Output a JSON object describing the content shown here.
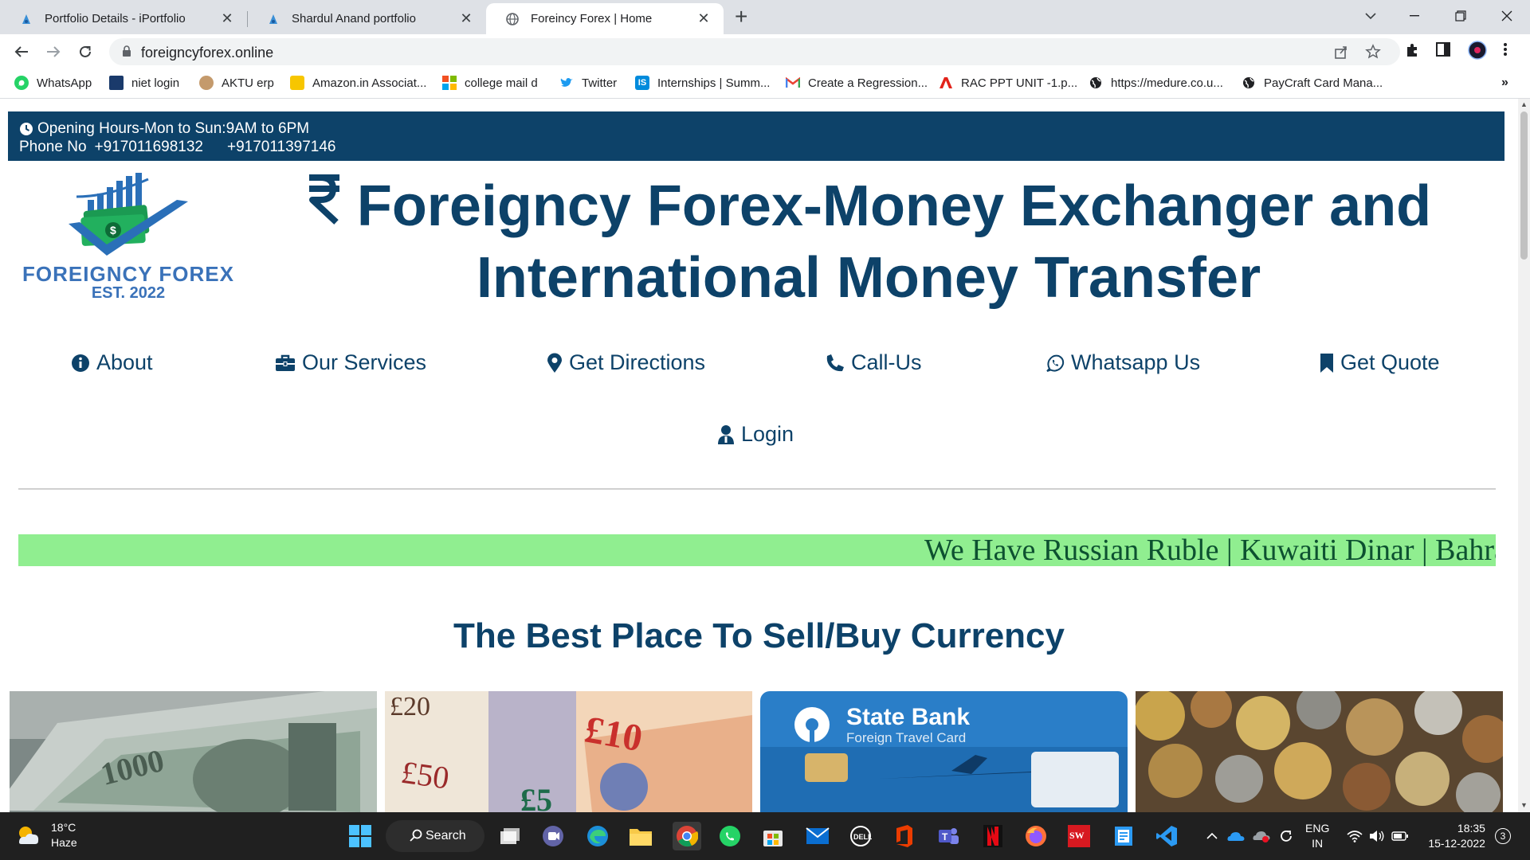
{
  "browser": {
    "tabs": [
      {
        "title": "Portfolio Details - iPortfolio",
        "active": false
      },
      {
        "title": "Shardul Anand portfolio",
        "active": false
      },
      {
        "title": "Foreincy Forex | Home",
        "active": true
      }
    ],
    "url": "foreigncyforex.online",
    "bookmarks": [
      {
        "label": "WhatsApp",
        "icon": "whatsapp-icon",
        "color": "#25d366"
      },
      {
        "label": "niet login",
        "icon": "niet-icon",
        "color": "#1a3a6b"
      },
      {
        "label": "AKTU erp",
        "icon": "aktu-icon",
        "color": "#8b5a2b"
      },
      {
        "label": "Amazon.in Associat...",
        "icon": "amazon-icon",
        "color": "#f7c600"
      },
      {
        "label": "college mail d",
        "icon": "microsoft-icon",
        "color": "#f25022"
      },
      {
        "label": "Twitter",
        "icon": "twitter-icon",
        "color": "#1d9bf0"
      },
      {
        "label": "Internships | Summ...",
        "icon": "internshala-icon",
        "color": "#008bdc"
      },
      {
        "label": "Create a Regression...",
        "icon": "gmail-icon",
        "color": "#ea4335"
      },
      {
        "label": "RAC PPT UNIT -1.p...",
        "icon": "pdf-icon",
        "color": "#e2231a"
      },
      {
        "label": "https://medure.co.u...",
        "icon": "globe-icon",
        "color": "#202124"
      },
      {
        "label": "PayCraft Card Mana...",
        "icon": "globe-icon",
        "color": "#202124"
      }
    ]
  },
  "site": {
    "opening_hours": "Opening Hours-Mon to Sun:9AM to 6PM",
    "phone_label": "Phone No",
    "phone1": "+917011698132",
    "phone2": "+917011397146",
    "logo_name": "FOREIGNCY FOREX",
    "logo_est": "EST. 2022",
    "title_line1": "Foreigncy Forex-Money Exchanger and",
    "title_line2": "International Money Transfer",
    "nav": [
      {
        "label": "About",
        "icon": "info-icon"
      },
      {
        "label": "Our Services",
        "icon": "briefcase-icon"
      },
      {
        "label": "Get Directions",
        "icon": "map-pin-icon"
      },
      {
        "label": "Call-Us",
        "icon": "phone-icon"
      },
      {
        "label": "Whatsapp Us",
        "icon": "whatsapp-icon"
      },
      {
        "label": "Get Quote",
        "icon": "bookmark-icon"
      },
      {
        "label": "Login",
        "icon": "user-icon"
      }
    ],
    "ticker_text": "We Have Russian Ruble | Kuwaiti Dinar | Bahra",
    "section_heading": "The Best Place To Sell/Buy Currency",
    "gallery": [
      {
        "alt": "Russian ruble banknotes",
        "text": "1000"
      },
      {
        "alt": "British pound banknotes",
        "text": "£20 £10 £50 £5"
      },
      {
        "alt": "State Bank Foreign Travel Card",
        "text": "State Bank",
        "subtext": "Foreign Travel Card"
      },
      {
        "alt": "Pile of coins"
      }
    ],
    "colors": {
      "primary": "#0d4269",
      "ticker_bg": "#90ee90",
      "ticker_text": "#0d5130",
      "logo": "#3a72b9"
    }
  },
  "taskbar": {
    "weather_temp": "18°C",
    "weather_desc": "Haze",
    "search_label": "Search",
    "lang_line1": "ENG",
    "lang_line2": "IN",
    "time": "18:35",
    "date": "15-12-2022",
    "notification_count": "3"
  }
}
